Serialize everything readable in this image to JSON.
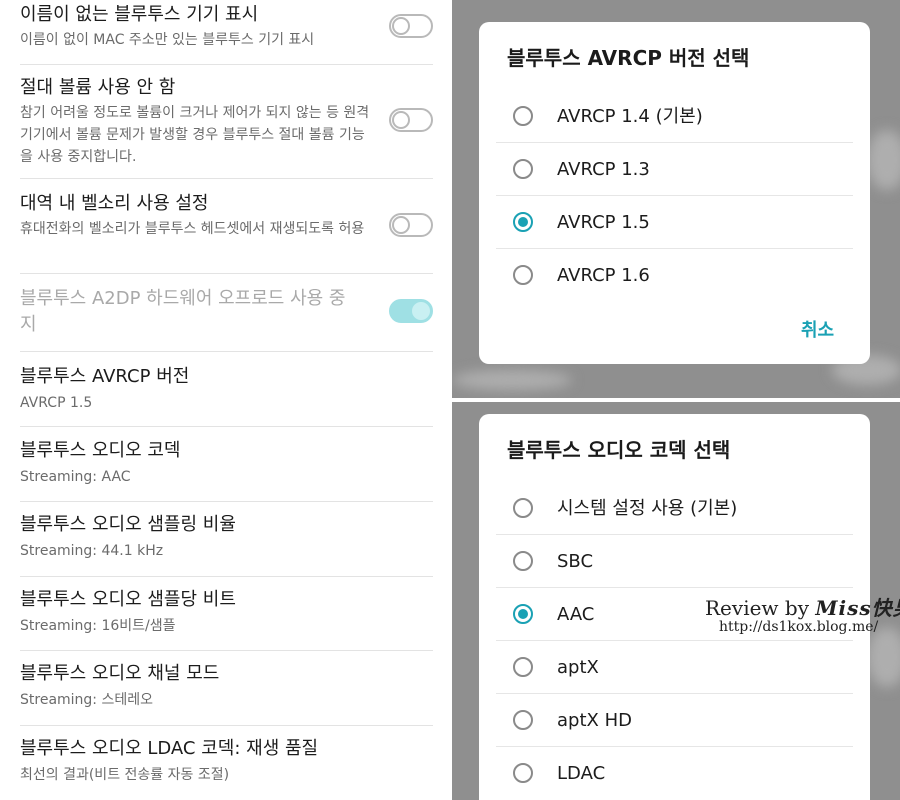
{
  "settings": [
    {
      "title": "이름이 없는 블루투스 기기 표시",
      "subtitle": "이름이 없이 MAC 주소만 있는 블루투스 기기 표시",
      "toggle": "off"
    },
    {
      "title": "절대 볼륨 사용 안 함",
      "subtitle": "참기 어려울 정도로 볼륨이 크거나 제어가 되지 않는 등 원격 기기에서 볼륨 문제가 발생할 경우 블루투스 절대 볼륨 기능을 사용 중지합니다.",
      "toggle": "off"
    },
    {
      "title": "대역 내 벨소리 사용 설정",
      "subtitle": "휴대전화의 벨소리가 블루투스 헤드셋에서 재생되도록 허용",
      "toggle": "off"
    },
    {
      "title": "블루투스 A2DP 하드웨어 오프로드 사용 중지",
      "toggle": "on",
      "disabled": true
    },
    {
      "title": "블루투스 AVRCP 버전",
      "subtitle": "AVRCP 1.5"
    },
    {
      "title": "블루투스 오디오 코덱",
      "subtitle": "Streaming: AAC"
    },
    {
      "title": "블루투스 오디오 샘플링 비율",
      "subtitle": "Streaming: 44.1 kHz"
    },
    {
      "title": "블루투스 오디오 샘플당 비트",
      "subtitle": "Streaming: 16비트/샘플"
    },
    {
      "title": "블루투스 오디오 채널 모드",
      "subtitle": "Streaming: 스테레오"
    },
    {
      "title": "블루투스 오디오 LDAC 코덱: 재생 품질",
      "subtitle": "최선의 결과(비트 전송률 자동 조절)"
    }
  ],
  "avrcp_dialog": {
    "title": "블루투스 AVRCP 버전 선택",
    "options": [
      "AVRCP 1.4 (기본)",
      "AVRCP 1.3",
      "AVRCP 1.5",
      "AVRCP 1.6"
    ],
    "selected_index": 2,
    "cancel_label": "취소"
  },
  "codec_dialog": {
    "title": "블루투스 오디오 코덱 선택",
    "options": [
      "시스템 설정 사용 (기본)",
      "SBC",
      "AAC",
      "aptX",
      "aptX HD",
      "LDAC"
    ],
    "selected_index": 2
  },
  "watermark": {
    "review_by": "Review by",
    "brand": "Miss快男",
    "trademark": "™",
    "url": "http://ds1kox.blog.me/"
  },
  "colors": {
    "accent": "#1aa1b4",
    "toggle_on_track": "#9fe0e4",
    "backdrop": "#8f8f8f"
  }
}
